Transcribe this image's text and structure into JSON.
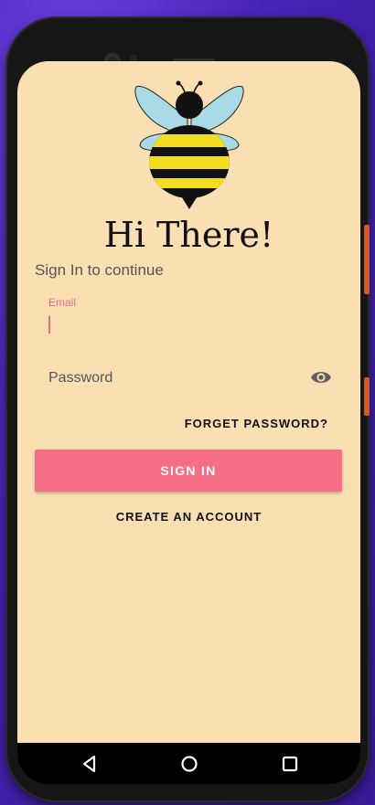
{
  "login": {
    "title": "Hi There!",
    "subtitle": "Sign In to continue",
    "email_label": "Email",
    "email_value": "",
    "password_placeholder": "Password",
    "forget_password": "FORGET PASSWORD?",
    "sign_in": "SIGN IN",
    "create_account": "CREATE AN ACCOUNT"
  },
  "icons": {
    "logo": "bee-icon",
    "password_toggle": "eye-icon",
    "nav_back": "back-triangle-icon",
    "nav_home": "home-circle-icon",
    "nav_recents": "recents-square-icon"
  },
  "colors": {
    "background": "#f9dfb2",
    "accent": "#f46e85",
    "email_label": "#e26d84"
  }
}
